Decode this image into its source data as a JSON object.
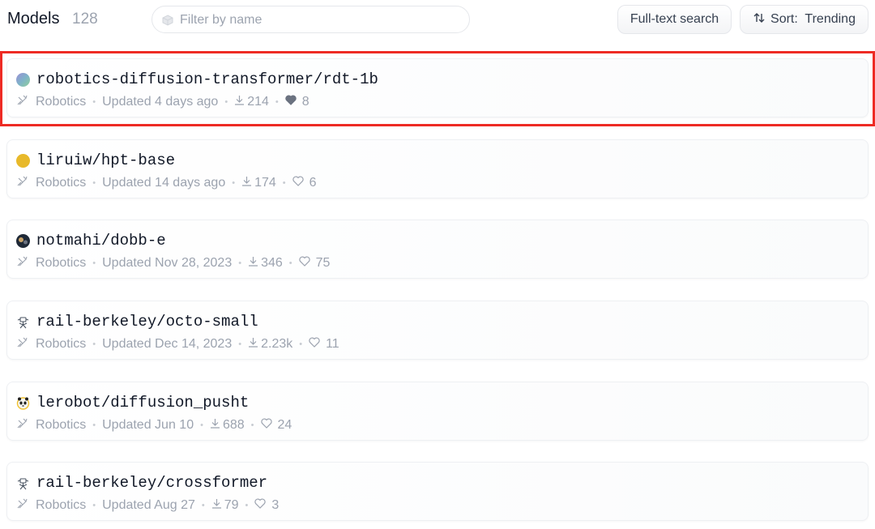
{
  "header": {
    "title": "Models",
    "count": "128",
    "filter_placeholder": "Filter by name",
    "full_text_search": "Full-text search",
    "sort_label": "Sort:  Trending"
  },
  "models": [
    {
      "name": "robotics-diffusion-transformer/rdt-1b",
      "task": "Robotics",
      "updated": "Updated 4 days ago",
      "downloads": "214",
      "likes": "8",
      "liked": true,
      "avatar": "gradient-circle"
    },
    {
      "name": "liruiw/hpt-base",
      "task": "Robotics",
      "updated": "Updated 14 days ago",
      "downloads": "174",
      "likes": "6",
      "liked": false,
      "avatar": "yellow-circle"
    },
    {
      "name": "notmahi/dobb-e",
      "task": "Robotics",
      "updated": "Updated Nov 28, 2023",
      "downloads": "346",
      "likes": "75",
      "liked": false,
      "avatar": "dark-photo"
    },
    {
      "name": "rail-berkeley/octo-small",
      "task": "Robotics",
      "updated": "Updated Dec 14, 2023",
      "downloads": "2.23k",
      "likes": "11",
      "liked": false,
      "avatar": "robot-sketch"
    },
    {
      "name": "lerobot/diffusion_pusht",
      "task": "Robotics",
      "updated": "Updated Jun 10",
      "downloads": "688",
      "likes": "24",
      "liked": false,
      "avatar": "panda-emoji"
    },
    {
      "name": "rail-berkeley/crossformer",
      "task": "Robotics",
      "updated": "Updated Aug 27",
      "downloads": "79",
      "likes": "3",
      "liked": false,
      "avatar": "robot-sketch"
    }
  ],
  "colors": {
    "highlight": "#ee2b24",
    "text": "#111827",
    "muted": "#9ca3af",
    "accent_yellow": "#e8b92a"
  }
}
